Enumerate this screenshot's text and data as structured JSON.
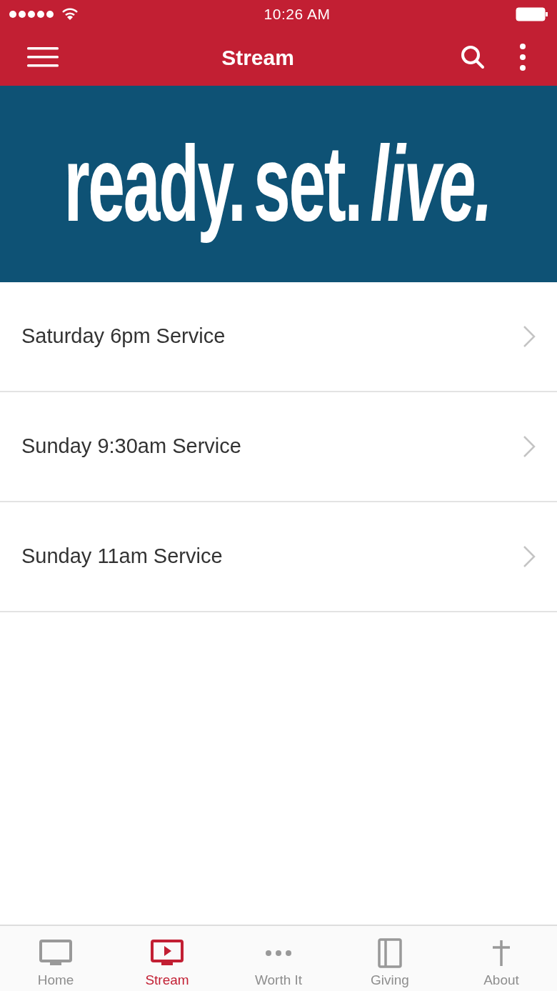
{
  "status_bar": {
    "time": "10:26 AM"
  },
  "nav_bar": {
    "title": "Stream"
  },
  "banner": {
    "words": [
      {
        "text": "ready.",
        "italic": false
      },
      {
        "text": "set.",
        "italic": false
      },
      {
        "text": "live.",
        "italic": true
      }
    ]
  },
  "services": [
    {
      "label": "Saturday 6pm Service"
    },
    {
      "label": "Sunday 9:30am Service"
    },
    {
      "label": "Sunday 11am Service"
    }
  ],
  "tabs": [
    {
      "label": "Home",
      "kind": "tv",
      "selected": false
    },
    {
      "label": "Stream",
      "kind": "play",
      "selected": true
    },
    {
      "label": "Worth It",
      "kind": "dots",
      "selected": false
    },
    {
      "label": "Giving",
      "kind": "book",
      "selected": false
    },
    {
      "label": "About",
      "kind": "cross",
      "selected": false
    }
  ]
}
